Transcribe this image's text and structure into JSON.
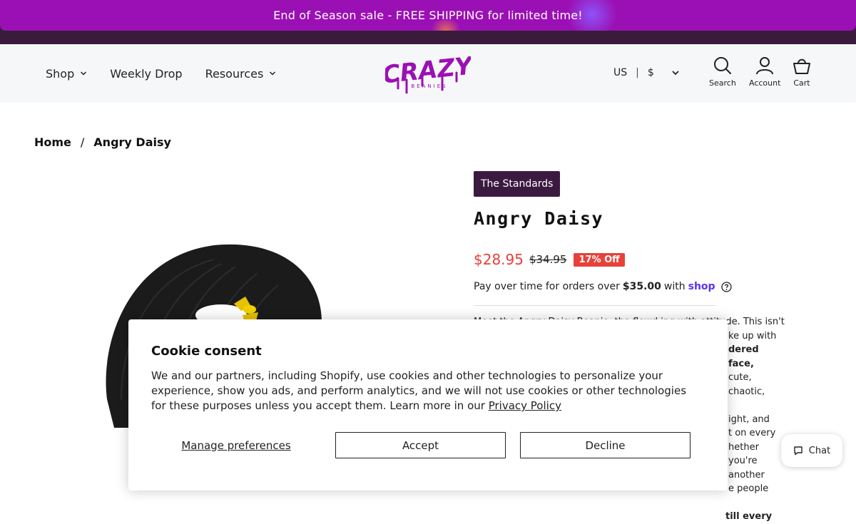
{
  "announcement": {
    "text": "End of Season sale - FREE SHIPPING for limited time!"
  },
  "header": {
    "nav": [
      {
        "label": "Shop",
        "has_dropdown": true
      },
      {
        "label": "Weekly Drop",
        "has_dropdown": false
      },
      {
        "label": "Resources",
        "has_dropdown": true
      }
    ],
    "logo": {
      "main": "CRAZY",
      "sub": "BEANIES"
    },
    "locale": {
      "country": "US",
      "separator": "|",
      "currency": "$"
    },
    "icons": [
      {
        "icon": "search-icon",
        "label": "Search"
      },
      {
        "icon": "account-icon",
        "label": "Account"
      },
      {
        "icon": "cart-icon",
        "label": "Cart"
      }
    ]
  },
  "breadcrumb": {
    "home": "Home",
    "separator": "/",
    "current": "Angry Daisy"
  },
  "product": {
    "collection": "The Standards",
    "title": "Angry Daisy",
    "price": "$28.95",
    "compare_price": "$34.95",
    "discount": "17% Off",
    "installments": {
      "prefix": "Pay over time for orders over",
      "amount": "$35.00",
      "middle": "with",
      "brand": "shop"
    },
    "description": [
      "Meet the Angry Daisy Beanie, the flowd ing with attitude. This isn't",
      "ke up with",
      "dered face,",
      "cute, chaotic,",
      "ight, and",
      "t on every",
      "hether you're",
      "another",
      "e people",
      "till every"
    ]
  },
  "cookie": {
    "title": "Cookie consent",
    "body": "We and our partners, including Shopify, use cookies and other technologies to personalize your experience, show you ads, and perform analytics, and we will not use cookies or other technologies for these purposes unless you accept them. Learn more in our",
    "link": "Privacy Policy",
    "manage": "Manage preferences",
    "accept": "Accept",
    "decline": "Decline"
  },
  "chat": {
    "label": "Chat"
  },
  "colors": {
    "announcement": "#9b10b4",
    "brand_purple": "#9b10b4",
    "sale_red": "#e8413a",
    "badge_dark": "#3b1a40",
    "shop_purple": "#5a31f4"
  }
}
